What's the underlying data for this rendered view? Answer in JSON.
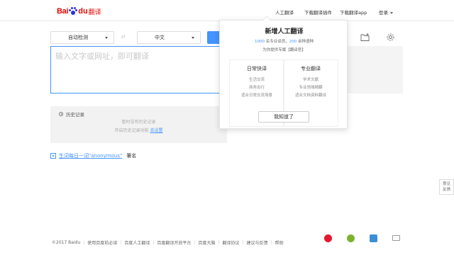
{
  "header": {
    "logo_bai": "Bai",
    "logo_du": "du",
    "logo_fanyi": "翻译",
    "nav": {
      "human_translation": "人工翻译",
      "download_plugin": "下载翻译插件",
      "download_app": "下载翻译app",
      "login": "登录"
    }
  },
  "translator": {
    "source_lang": "自动检测",
    "swap_label": "⇄",
    "target_lang": "中文",
    "input_placeholder": "输入文字或网址，即可翻译",
    "accent_color": "#4395ff"
  },
  "history": {
    "title": "历史记录",
    "line1": "暂时没有历史记录",
    "line2_prefix": "开启历史记录功能 ",
    "line2_link": "去设置"
  },
  "daily": {
    "link": "生词每日一词\"anonymous\"",
    "signature": "署名"
  },
  "feedback": {
    "line1": "意见",
    "line2": "反馈"
  },
  "footer": {
    "items": [
      "©2017 Baidu",
      "使用百度前必读",
      "百度人工翻译",
      "百度翻译开放平台",
      "百度大脑",
      "翻译协议",
      "建议与反馈",
      "帮助"
    ]
  },
  "popup": {
    "title": "新增人工翻译",
    "sub_count": "1000",
    "sub_mid": " 名专业译员，",
    "sub_lang": "200",
    "sub_tail": " 余种语种",
    "sub2": "为你提供专属【翻译官】",
    "daily_col": {
      "title": "日常快译",
      "items": [
        "生活交流",
        "商务出行",
        "适合日常交流场景"
      ]
    },
    "pro_col": {
      "title": "专业翻译",
      "items": [
        "学术文献",
        "专业领域精翻",
        "适合文档资料翻译"
      ]
    },
    "ok_button": "我知道了"
  },
  "social": {
    "weibo_color": "#e6162d",
    "wechat_color": "#7bb32e",
    "tieba_color": "#3a8fd7",
    "mail_color": "#999999"
  }
}
